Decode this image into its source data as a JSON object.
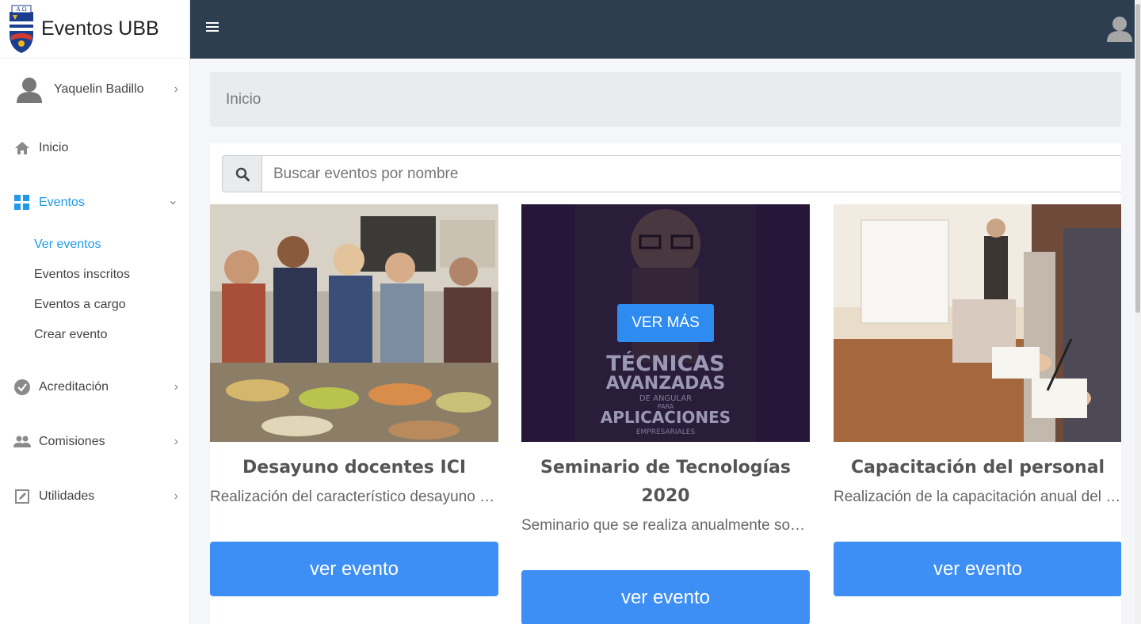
{
  "brand": {
    "name": "Eventos UBB"
  },
  "user": {
    "name": "Yaquelin Badillo"
  },
  "nav": {
    "inicio": "Inicio",
    "eventos": "Eventos",
    "eventos_sub": [
      "Ver eventos",
      "Eventos inscritos",
      "Eventos a cargo",
      "Crear evento"
    ],
    "acreditacion": "Acreditación",
    "comisiones": "Comisiones",
    "utilidades": "Utilidades"
  },
  "breadcrumb": "Inicio",
  "search": {
    "placeholder": "Buscar eventos por nombre"
  },
  "cards": [
    {
      "title": "Desayuno docentes ICI",
      "description": "Realización del característico desayuno anual de docentes ICI",
      "button": "ver evento"
    },
    {
      "title": "Seminario de Tecnologías 2020",
      "description": "Seminario que se realiza anualmente sobre tecnologías",
      "button": "ver evento",
      "overlay_button": "VER MÁS",
      "image_text": [
        "TÉCNICAS",
        "AVANZADAS",
        "DE ANGULAR",
        "PARA",
        "APLICACIONES",
        "EMPRESARIALES"
      ]
    },
    {
      "title": "Capacitación del personal",
      "description": "Realización de la capacitación anual del personal",
      "button": "ver evento"
    }
  ],
  "colors": {
    "accent": "#1e9aed",
    "topbar": "#2d3e50",
    "button": "#3d8ef5"
  }
}
